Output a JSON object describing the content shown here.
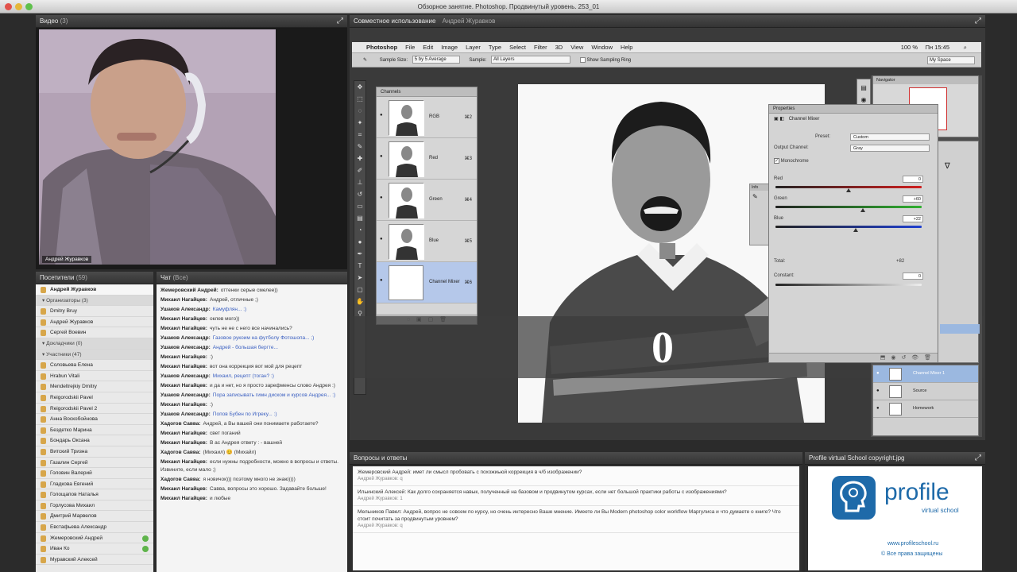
{
  "window": {
    "title": "Обзорное занятие. Photoshop. Продвинутый уровень. 253_01"
  },
  "video": {
    "title": "Видео",
    "count": "(3)",
    "presenter_name": "Андрей Журавков"
  },
  "shared": {
    "title": "Совместное использование",
    "subtitle": "Андрей Журавков"
  },
  "participants": {
    "title": "Посетители",
    "count": "(59)",
    "me": "Андрей Журавков",
    "groups": [
      {
        "label": "Организаторы (3)",
        "items": [
          "Dmitry Bruy",
          "Андрей Журавков",
          "Сергей Воевин"
        ]
      },
      {
        "label": "Докладчики (0)",
        "items": []
      },
      {
        "label": "Участники (47)",
        "items": [
          "Соловьева Елена",
          "Hrabun Vitali",
          "Mendeltrejkiy Dmitry",
          "Reigorodskii Pavel",
          "Reigorodskii Pavel 2",
          "Анна Воскобойнова",
          "Бездетко Марина",
          "Бондарь Оксана",
          "Витский Тризна",
          "Газалин Сергей",
          "Головин Валерий",
          "Гладкова Евгений",
          "Голощапов Наталья",
          "Горлусова Михаил",
          "Дмитрий Марвелов",
          "Евстафьева Александр",
          "Жемеровский Андрей",
          "Иван Ко",
          "Муравский Алексей"
        ]
      }
    ]
  },
  "chat": {
    "title": "Чат",
    "count": "(Все)",
    "messages": [
      {
        "author": "Жемеровский Андрей:",
        "text": "оттенки серые смелее))",
        "blue": false
      },
      {
        "author": "Михаил Нагайцев:",
        "text": "Андрей, отличные ;)",
        "blue": false
      },
      {
        "author": "Ушаков Александр:",
        "text": "Камуфлян... :)",
        "blue": true
      },
      {
        "author": "Михаил Нагайцев:",
        "text": "оклев мого))",
        "blue": false
      },
      {
        "author": "Михаил Нагайцев:",
        "text": "чуть не не с него все начинались?",
        "blue": false
      },
      {
        "author": "Ушаков Александр:",
        "text": "Газовое рукоим на футболу Фотошопа... ;)",
        "blue": true
      },
      {
        "author": "Ушаков Александр:",
        "text": "Андрей - большая бергте...",
        "blue": true
      },
      {
        "author": "Михаил Нагайцев:",
        "text": ":)",
        "blue": false
      },
      {
        "author": "Михаил Нагайцев:",
        "text": "вот она коррекция вот мой для рецепт",
        "blue": false
      },
      {
        "author": "Ушаков Александр:",
        "text": "Михаил, рецепт (тоган? :)",
        "blue": true
      },
      {
        "author": "Михаил Нагайцев:",
        "text": "и да и нет, но я просто зарефменсы слово Андрея :)",
        "blue": false
      },
      {
        "author": "Ушаков Александр:",
        "text": "Пора записывать гимн диском и курсов Андрея... :)",
        "blue": true
      },
      {
        "author": "Михаил Нагайцев:",
        "text": ":)",
        "blue": false
      },
      {
        "author": "Ушаков Александр:",
        "text": "Попов Бубен по Игреку... :)",
        "blue": true
      },
      {
        "author": "Хадогов Савва:",
        "text": "Андрей, а Вы вашей они понимаете работаете?",
        "blue": false
      },
      {
        "author": "Михаил Нагайцев:",
        "text": "свет поганий",
        "blue": false
      },
      {
        "author": "Михаил Нагайцев:",
        "text": "В ас Андрея ответу : - вашней",
        "blue": false
      },
      {
        "author": "Хадогов Савва:",
        "text": "(Михаил) 😊 (Михайл)",
        "blue": false
      },
      {
        "author": "Михаил Нагайцев:",
        "text": "если нужны подробности, можно в вопросы и ответы. Извините, если мало ;)",
        "blue": false
      },
      {
        "author": "Хадогов Савва:",
        "text": "я новичок))) поэтому много не знаю))))",
        "blue": false
      },
      {
        "author": "Михаил Нагайцев:",
        "text": "Савва, вопросы это хорошо. Задавайте больше!",
        "blue": false
      },
      {
        "author": "Михаил Нагайцев:",
        "text": "и любые",
        "blue": false
      }
    ]
  },
  "photoshop": {
    "menu": [
      "Photoshop",
      "File",
      "Edit",
      "Image",
      "Layer",
      "Type",
      "Select",
      "Filter",
      "3D",
      "View",
      "Window",
      "Help"
    ],
    "clock": "Пн 15:45",
    "zoom": "100 %",
    "options": {
      "sample_size_label": "Sample Size:",
      "sample_size": "5 by 5 Average",
      "sample_label": "Sample:",
      "sample": "All Layers",
      "show_ring": "Show Sampling Ring",
      "workspace": "My Space"
    },
    "channels_title": "Channels",
    "channels": [
      {
        "name": "RGB",
        "shortcut": "⌘2"
      },
      {
        "name": "Red",
        "shortcut": "⌘3"
      },
      {
        "name": "Green",
        "shortcut": "⌘4"
      },
      {
        "name": "Blue",
        "shortcut": "⌘5"
      },
      {
        "name": "Channel Mixer",
        "shortcut": "⌘6"
      }
    ],
    "properties": {
      "title": "Properties",
      "panel": "Channel Mixer",
      "preset_label": "Preset:",
      "preset": "Custom",
      "output_label": "Output Channel:",
      "output": "Gray",
      "monochrome": "Monochrome",
      "sliders": [
        {
          "name": "Red",
          "value": "0"
        },
        {
          "name": "Green",
          "value": "+60"
        },
        {
          "name": "Blue",
          "value": "+22"
        }
      ],
      "total_label": "Total:",
      "total": "+82",
      "constant_label": "Constant:",
      "constant": "0"
    },
    "navigator_title": "Navigator",
    "layers": [
      {
        "name": "Channel Mixer 1"
      },
      {
        "name": "Source"
      },
      {
        "name": "Homework"
      }
    ],
    "overlay_digit": "0",
    "info_title": "Info"
  },
  "qa": {
    "title": "Вопросы и ответы",
    "items": [
      {
        "q": "Жемеровский Андрей: имет ли смысл пробовать с похожиьюй коррекция в ч/б изображении?",
        "a": "Андрей Журавков: q"
      },
      {
        "q": "Ильинский Алексей: Как долго сохраняется навык, полученный на базовом и продвинутом курсах, если нет большой практики работы с изображениями?",
        "a": "Андрей Журавков: 1"
      },
      {
        "q": "Мельников Павел: Андрей, вопрос не совсем по курсу, но очень интересно Ваше мнение. Имеете ли Вы Modern photoshop color workflow Маргулиса и что думаете о книге? Что стоит почитать за продвинутым уровнем?",
        "a": "Андрей Журавков: q"
      }
    ]
  },
  "copyright": {
    "title": "Profile virtual School copyright.jpg",
    "brand": "profile",
    "tagline": "virtual school",
    "url": "www.profileschool.ru",
    "rights": "© Все права защищены"
  }
}
